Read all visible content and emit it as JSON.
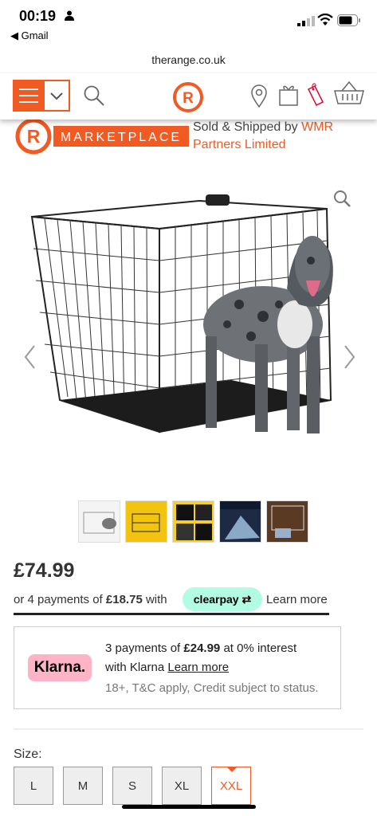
{
  "status_bar": {
    "time": "00:19",
    "back_app": "◀ Gmail"
  },
  "browser": {
    "url": "therange.co.uk"
  },
  "header": {
    "icons": [
      "menu-icon",
      "chevron-down-icon",
      "search-icon",
      "range-logo",
      "location-pin-icon",
      "gift-icon",
      "price-tag-icon",
      "basket-icon"
    ],
    "accent_color": "#f15a22"
  },
  "marketplace": {
    "logo_letter": "R",
    "logo_text": "MARKETPLACE",
    "sold_label": "Sold & Shipped by ",
    "seller": "WMR Partners Limited"
  },
  "product": {
    "image_alt": "Black wire dog crate with Great Dane",
    "thumbnail_count": 5,
    "price": "£74.99"
  },
  "clearpay": {
    "prefix": "or 4 payments of ",
    "amount": "£18.75",
    "suffix": " with",
    "badge": "clearpay",
    "learn_more": "Learn more",
    "badge_color": "#b2fce4"
  },
  "klarna": {
    "badge": "Klarna.",
    "line1_prefix": "3 payments of ",
    "line1_amount": "£24.99",
    "line1_suffix": " at 0% interest",
    "line2_prefix": "with Klarna ",
    "learn_more": "Learn more",
    "line3": "18+, T&C apply, Credit subject to status.",
    "badge_color": "#ffb3c7"
  },
  "size": {
    "label": "Size:",
    "options": [
      "L",
      "M",
      "S",
      "XL",
      "XXL"
    ],
    "selected": "XXL"
  }
}
